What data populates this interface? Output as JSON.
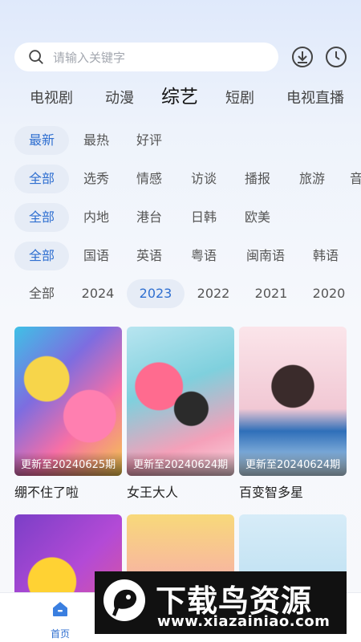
{
  "search": {
    "placeholder": "请输入关键字"
  },
  "categories": [
    {
      "label": "电视剧",
      "active": false
    },
    {
      "label": "动漫",
      "active": false
    },
    {
      "label": "综艺",
      "active": true
    },
    {
      "label": "短剧",
      "active": false
    },
    {
      "label": "电视直播",
      "active": false
    }
  ],
  "filters": {
    "sort": [
      "最新",
      "最热",
      "好评"
    ],
    "type": [
      "全部",
      "选秀",
      "情感",
      "访谈",
      "播报",
      "旅游",
      "音"
    ],
    "region": [
      "全部",
      "内地",
      "港台",
      "日韩",
      "欧美"
    ],
    "language": [
      "全部",
      "国语",
      "英语",
      "粤语",
      "闽南语",
      "韩语"
    ],
    "year": [
      "全部",
      "2024",
      "2023",
      "2022",
      "2021",
      "2020"
    ]
  },
  "cards": [
    {
      "title": "绷不住了啦",
      "update": "更新至20240625期"
    },
    {
      "title": "女王大人",
      "update": "更新至20240624期"
    },
    {
      "title": "百变智多星",
      "update": "更新至20240624期"
    },
    {
      "title": "",
      "update": ""
    },
    {
      "title": "",
      "update": ""
    },
    {
      "title": "",
      "update": ""
    }
  ],
  "bottom_nav": {
    "home_label": "首页"
  },
  "watermark": {
    "title": "下载鸟资源",
    "url": "www.xiazainiao.com"
  },
  "colors": {
    "accent": "#2f6fd0",
    "chip_bg": "#e6ecf6"
  }
}
